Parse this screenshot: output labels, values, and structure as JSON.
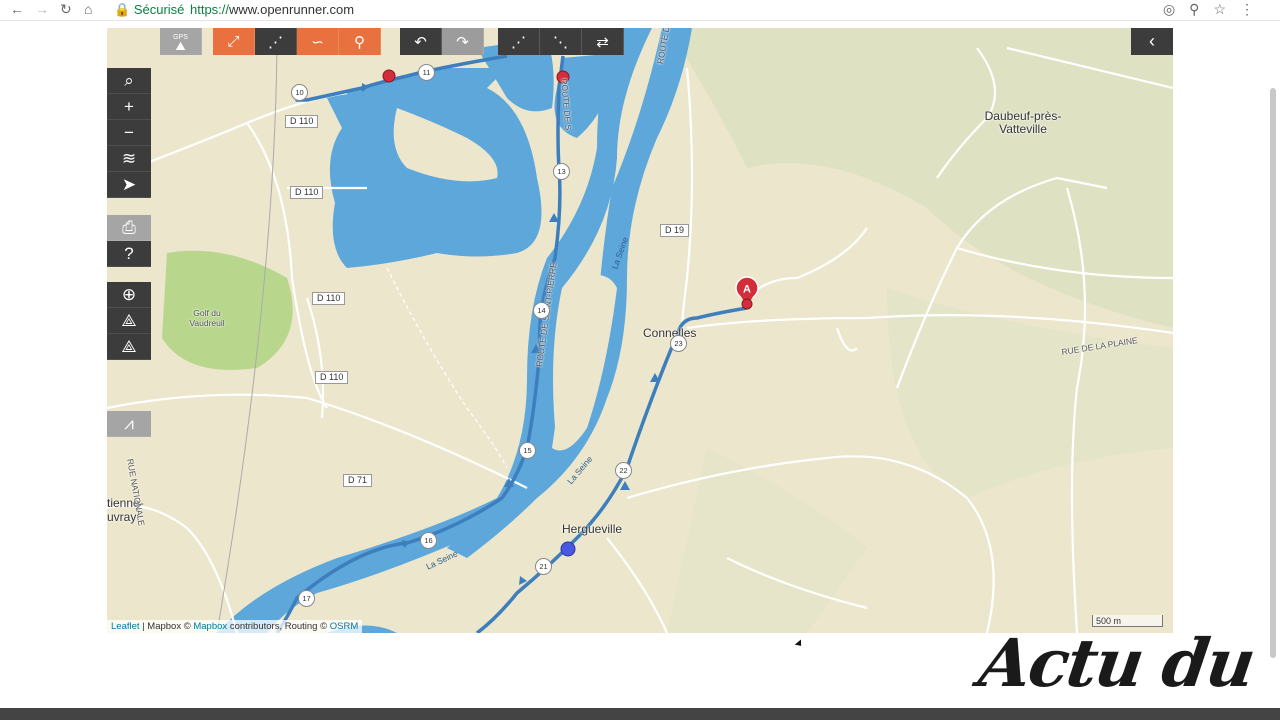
{
  "browser": {
    "secure_label": "Sécurisé",
    "url_scheme": "https://",
    "url_host": "www.openrunner.com"
  },
  "toolbar": {
    "gps_label": "GPS"
  },
  "map": {
    "place_labels": {
      "daubeuf": "Daubeuf-près-Vatteville",
      "connelles": "Connelles",
      "hergueville": "Hergueville",
      "golf": "Golf du Vaudreuil",
      "etienne": "tienne-uvray"
    },
    "road_labels": {
      "d110_a": "D 110",
      "d110_b": "D 110",
      "d110_c": "D 110",
      "d110_d": "D 110",
      "d19": "D 19",
      "d71": "D 71",
      "rue_plaine": "RUE DE LA PLAINE",
      "route_amfreville": "ROUTE D'AMFREV",
      "rue_nationale": "RUE NATIONALE",
      "seine_1": "La Seine",
      "seine_2": "La Seine",
      "seine_3": "La Seine",
      "route_saint": "ROUTE DE S",
      "route_saint_pierre": "ROUTE DE SAINT-PIERRE"
    },
    "km_markers": [
      "10",
      "11",
      "13",
      "14",
      "15",
      "16",
      "17",
      "21",
      "22",
      "23"
    ],
    "marker_label": "A",
    "scale": "500 m",
    "attribution": {
      "leaflet": "Leaflet",
      "mapbox_pre": "| Mapbox ©",
      "mapbox": "Mapbox",
      "mid": "contributors, Routing ©",
      "osrm": "OSRM"
    }
  },
  "overlay": {
    "logo_text": "Actu du"
  },
  "colors": {
    "route": "#3d7fbd",
    "water": "#5ea7db",
    "orange": "#e8713f",
    "dark": "#3c3c3c",
    "marker": "#d32d3b"
  }
}
